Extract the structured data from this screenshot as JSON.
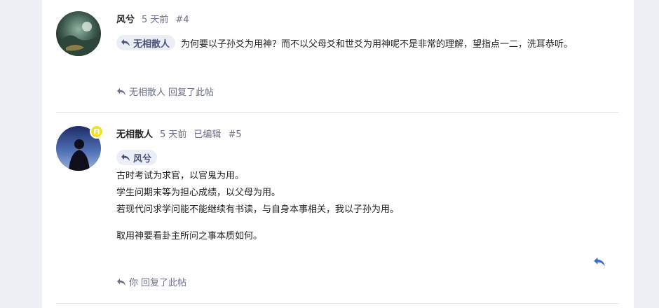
{
  "posts": [
    {
      "author": "风兮",
      "time": "5 天前",
      "number": "#4",
      "reply_to": "无相散人",
      "text": "为何要以子孙爻为用神？而不以父母爻和世爻为用神呢不是非常的理解，望指点一二，洗耳恭听。",
      "footer_name": "无相散人",
      "footer_text": "回复了此帖"
    },
    {
      "author": "无相散人",
      "time": "5 天前",
      "edited": "已编辑",
      "number": "#5",
      "reply_to": "风兮",
      "lines": [
        "古时考试为求官，以官鬼为用。",
        "学生问期末等为担心成绩，以父母为用。",
        "若现代问求学问能不能继续有书读，与自身本事相关，我以子孙为用。",
        "取用神要看卦主所问之事本质如何。"
      ],
      "footer_name": "你",
      "footer_text": "回复了此帖"
    }
  ],
  "colors": {
    "accent": "#3b6fd8",
    "muted": "#6b6f8a",
    "chip_bg": "#eceef6",
    "badge": "#f3e21a"
  },
  "icons": {
    "reply_chip": "reply-icon",
    "footer": "reply-icon",
    "action": "reply-icon",
    "badge": "user-icon"
  }
}
